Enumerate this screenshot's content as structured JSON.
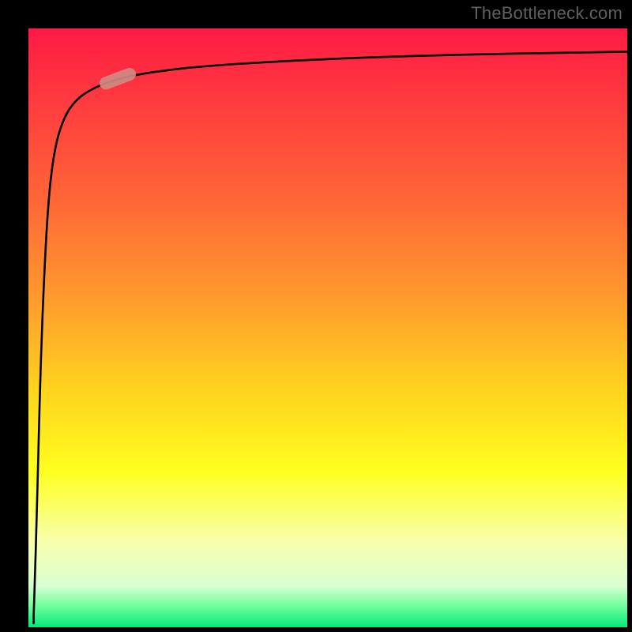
{
  "watermark": "TheBottleneck.com",
  "chart_data": {
    "type": "line",
    "title": "",
    "xlabel": "",
    "ylabel": "",
    "xlim": [
      0,
      100
    ],
    "ylim": [
      0,
      100
    ],
    "grid": false,
    "series": [
      {
        "name": "curve",
        "x": [
          1,
          1.2,
          1.5,
          1.8,
          2.2,
          2.8,
          3.5,
          4.5,
          6,
          8,
          11,
          15,
          20,
          28,
          40,
          55,
          72,
          88,
          100
        ],
        "y": [
          2,
          8,
          18,
          30,
          45,
          60,
          72,
          80,
          85,
          88,
          90,
          91.5,
          92.5,
          93.5,
          94.3,
          95,
          95.5,
          95.8,
          96
        ]
      }
    ],
    "marker": {
      "name": "highlight-pill",
      "curve_x": 15,
      "curve_y": 91.5,
      "color": "#cf8a82"
    },
    "background_gradient": {
      "stops": [
        {
          "offset": 0.0,
          "color": "#ff1a44"
        },
        {
          "offset": 0.12,
          "color": "#ff3a3f"
        },
        {
          "offset": 0.3,
          "color": "#ff6a36"
        },
        {
          "offset": 0.45,
          "color": "#ff9a2e"
        },
        {
          "offset": 0.6,
          "color": "#ffd21e"
        },
        {
          "offset": 0.74,
          "color": "#ffff20"
        },
        {
          "offset": 0.86,
          "color": "#f7ffb0"
        },
        {
          "offset": 0.93,
          "color": "#d8ffd0"
        },
        {
          "offset": 0.965,
          "color": "#6bff9c"
        },
        {
          "offset": 1.0,
          "color": "#00e878"
        }
      ]
    },
    "frame_color": "#000000",
    "curve_color": "#000000"
  }
}
